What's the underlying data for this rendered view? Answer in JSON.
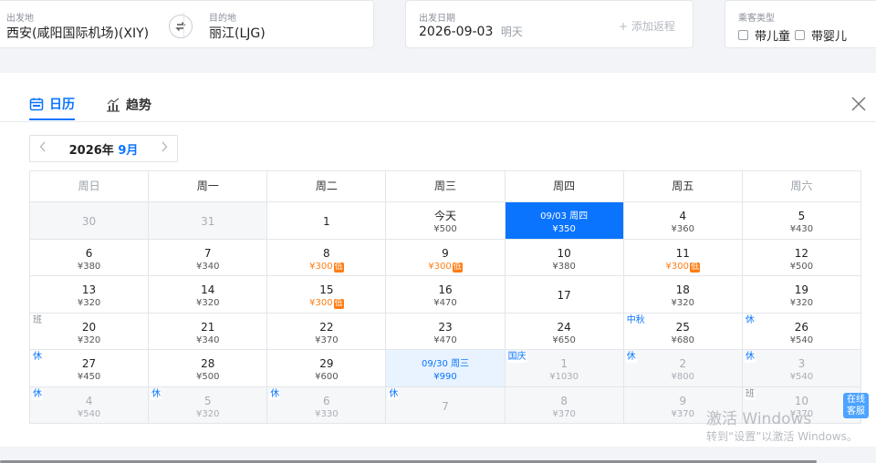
{
  "search": {
    "from_label": "出发地",
    "from_value": "西安(咸阳国际机场)(XIY)",
    "to_label": "目的地",
    "to_value": "丽江(LJG)",
    "date_label": "出发日期",
    "date_value": "2026-09-03",
    "date_hint": "明天",
    "add_return": "+ 添加返程",
    "pax_label": "乘客类型",
    "child_label": "带儿童",
    "infant_label": "带婴儿"
  },
  "calendar": {
    "tab_calendar": "日历",
    "tab_trend": "趋势",
    "year_label": "2026年",
    "month_label": "9月",
    "weekdays": [
      "周日",
      "周一",
      "周二",
      "周三",
      "周四",
      "周五",
      "周六"
    ],
    "weeks": [
      [
        {
          "day": "30",
          "price": "",
          "state": "other",
          "tag": "",
          "low": false
        },
        {
          "day": "31",
          "price": "",
          "state": "other",
          "tag": "",
          "low": false
        },
        {
          "day": "1",
          "price": "",
          "state": "normal",
          "tag": "",
          "low": false
        },
        {
          "day": "今天",
          "price": "¥500",
          "state": "normal",
          "tag": "",
          "low": false
        },
        {
          "day": "09/03 周四",
          "price": "¥350",
          "state": "selected",
          "tag": "",
          "low": false
        },
        {
          "day": "4",
          "price": "¥360",
          "state": "normal",
          "tag": "",
          "low": false
        },
        {
          "day": "5",
          "price": "¥430",
          "state": "normal",
          "tag": "",
          "low": false
        }
      ],
      [
        {
          "day": "6",
          "price": "¥380",
          "state": "normal",
          "tag": "",
          "low": false
        },
        {
          "day": "7",
          "price": "¥340",
          "state": "normal",
          "tag": "",
          "low": false
        },
        {
          "day": "8",
          "price": "¥300",
          "state": "normal",
          "tag": "",
          "low": true
        },
        {
          "day": "9",
          "price": "¥300",
          "state": "normal",
          "tag": "",
          "low": true
        },
        {
          "day": "10",
          "price": "¥380",
          "state": "normal",
          "tag": "",
          "low": false
        },
        {
          "day": "11",
          "price": "¥300",
          "state": "normal",
          "tag": "",
          "low": true
        },
        {
          "day": "12",
          "price": "¥500",
          "state": "normal",
          "tag": "",
          "low": false
        }
      ],
      [
        {
          "day": "13",
          "price": "¥320",
          "state": "normal",
          "tag": "",
          "low": false
        },
        {
          "day": "14",
          "price": "¥320",
          "state": "normal",
          "tag": "",
          "low": false
        },
        {
          "day": "15",
          "price": "¥300",
          "state": "normal",
          "tag": "",
          "low": true
        },
        {
          "day": "16",
          "price": "¥470",
          "state": "normal",
          "tag": "",
          "low": false
        },
        {
          "day": "17",
          "price": "",
          "state": "normal",
          "tag": "",
          "low": false
        },
        {
          "day": "18",
          "price": "¥320",
          "state": "normal",
          "tag": "",
          "low": false
        },
        {
          "day": "19",
          "price": "¥320",
          "state": "normal",
          "tag": "",
          "low": false
        }
      ],
      [
        {
          "day": "20",
          "price": "¥320",
          "state": "normal",
          "tag": "班",
          "low": false
        },
        {
          "day": "21",
          "price": "¥340",
          "state": "normal",
          "tag": "",
          "low": false
        },
        {
          "day": "22",
          "price": "¥370",
          "state": "normal",
          "tag": "",
          "low": false
        },
        {
          "day": "23",
          "price": "¥470",
          "state": "normal",
          "tag": "",
          "low": false
        },
        {
          "day": "24",
          "price": "¥650",
          "state": "normal",
          "tag": "",
          "low": false
        },
        {
          "day": "25",
          "price": "¥680",
          "state": "normal",
          "tag": "中秋",
          "low": false
        },
        {
          "day": "26",
          "price": "¥540",
          "state": "normal",
          "tag": "休",
          "low": false
        }
      ],
      [
        {
          "day": "27",
          "price": "¥450",
          "state": "normal",
          "tag": "休",
          "low": false
        },
        {
          "day": "28",
          "price": "¥500",
          "state": "normal",
          "tag": "",
          "low": false
        },
        {
          "day": "29",
          "price": "¥600",
          "state": "normal",
          "tag": "",
          "low": false
        },
        {
          "day": "09/30 周三",
          "price": "¥990",
          "state": "return",
          "tag": "",
          "low": false
        },
        {
          "day": "1",
          "price": "¥1030",
          "state": "other",
          "tag": "国庆",
          "low": false
        },
        {
          "day": "2",
          "price": "¥800",
          "state": "other",
          "tag": "休",
          "low": false
        },
        {
          "day": "3",
          "price": "¥540",
          "state": "other",
          "tag": "休",
          "low": false
        }
      ],
      [
        {
          "day": "4",
          "price": "¥540",
          "state": "other",
          "tag": "休",
          "low": false
        },
        {
          "day": "5",
          "price": "¥320",
          "state": "other",
          "tag": "休",
          "low": false
        },
        {
          "day": "6",
          "price": "¥330",
          "state": "other",
          "tag": "休",
          "low": false
        },
        {
          "day": "7",
          "price": "",
          "state": "other",
          "tag": "休",
          "low": false
        },
        {
          "day": "8",
          "price": "¥370",
          "state": "other",
          "tag": "",
          "low": false
        },
        {
          "day": "9",
          "price": "¥370",
          "state": "other",
          "tag": "",
          "low": false
        },
        {
          "day": "10",
          "price": "¥370",
          "state": "other",
          "tag": "班",
          "low": false
        }
      ]
    ],
    "low_tag": "低"
  },
  "watermark": {
    "line1": "激活 Windows",
    "line2": "转到“设置”以激活 Windows。"
  },
  "online_service": "在线客服",
  "colors": {
    "accent": "#0a74ff",
    "low_price": "#ff7d13",
    "return_bg": "#e8f3ff"
  }
}
